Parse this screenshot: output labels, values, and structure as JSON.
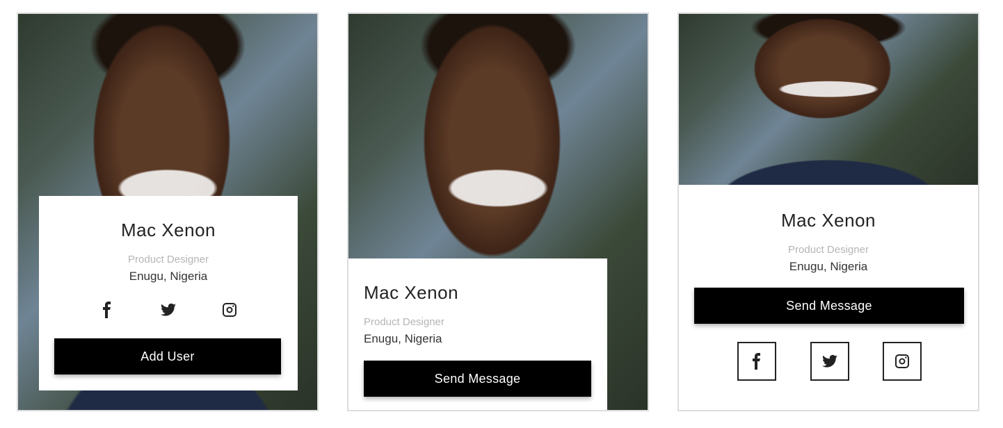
{
  "cards": [
    {
      "name": "Mac Xenon",
      "role": "Product Designer",
      "location": "Enugu, Nigeria",
      "button": "Add User",
      "socials": [
        "facebook-icon",
        "twitter-icon",
        "instagram-icon"
      ]
    },
    {
      "name": "Mac Xenon",
      "role": "Product Designer",
      "location": "Enugu, Nigeria",
      "button": "Send Message"
    },
    {
      "name": "Mac Xenon",
      "role": "Product Designer",
      "location": "Enugu, Nigeria",
      "button": "Send Message",
      "socials": [
        "facebook-icon",
        "twitter-icon",
        "instagram-icon"
      ]
    }
  ],
  "colors": {
    "button_bg": "#000000",
    "button_text": "#ffffff",
    "role_text": "#b5b5b5",
    "border": "#dcdcdc"
  }
}
